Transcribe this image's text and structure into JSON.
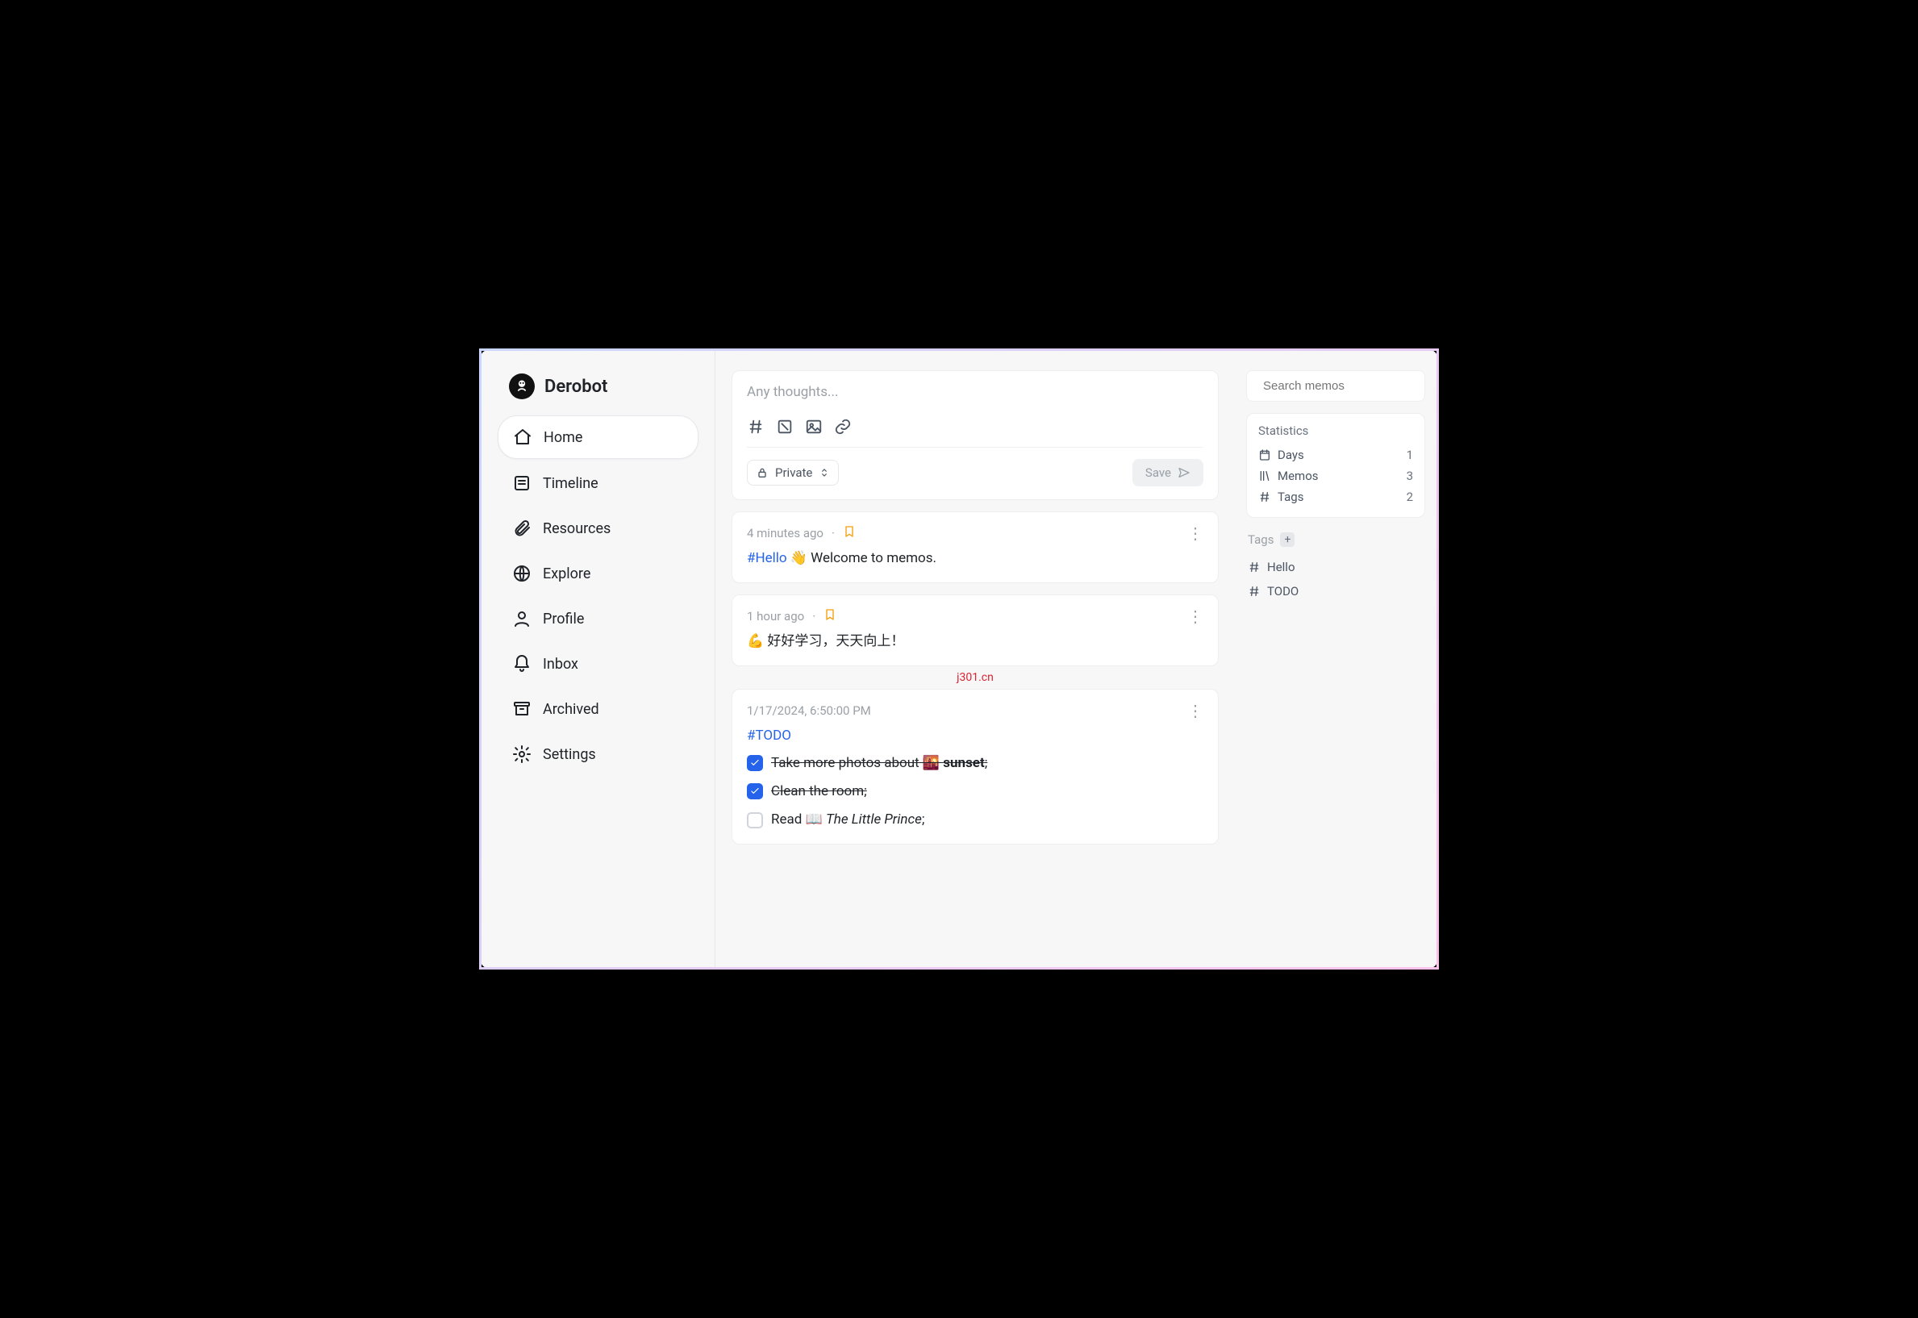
{
  "brand": {
    "name": "Derobot"
  },
  "nav": {
    "home": "Home",
    "timeline": "Timeline",
    "resources": "Resources",
    "explore": "Explore",
    "profile": "Profile",
    "inbox": "Inbox",
    "archived": "Archived",
    "settings": "Settings"
  },
  "editor": {
    "placeholder": "Any thoughts...",
    "visibility": "Private",
    "save": "Save"
  },
  "memos": [
    {
      "time": "4 minutes ago",
      "bookmarked": true,
      "tag": "#Hello",
      "after_tag": " 👋 Welcome to memos."
    },
    {
      "time": "1 hour ago",
      "bookmarked": true,
      "content": "💪 好好学习，天天向上！"
    },
    {
      "time": "1/17/2024, 6:50:00 PM",
      "tag": "#TODO",
      "todos": [
        {
          "checked": true,
          "pre": "Take more photos about 🌇 ",
          "bold": "sunset",
          "post": ";"
        },
        {
          "checked": true,
          "text": "Clean the room;"
        },
        {
          "checked": false,
          "pre": "Read 📖 ",
          "italic": "The Little Prince",
          "post": ";"
        }
      ]
    }
  ],
  "watermark": "j301.cn",
  "search": {
    "placeholder": "Search memos"
  },
  "stats": {
    "title": "Statistics",
    "days_label": "Days",
    "days": "1",
    "memos_label": "Memos",
    "memos": "3",
    "tags_label": "Tags",
    "tags": "2"
  },
  "tags": {
    "title": "Tags",
    "items": [
      "Hello",
      "TODO"
    ]
  }
}
